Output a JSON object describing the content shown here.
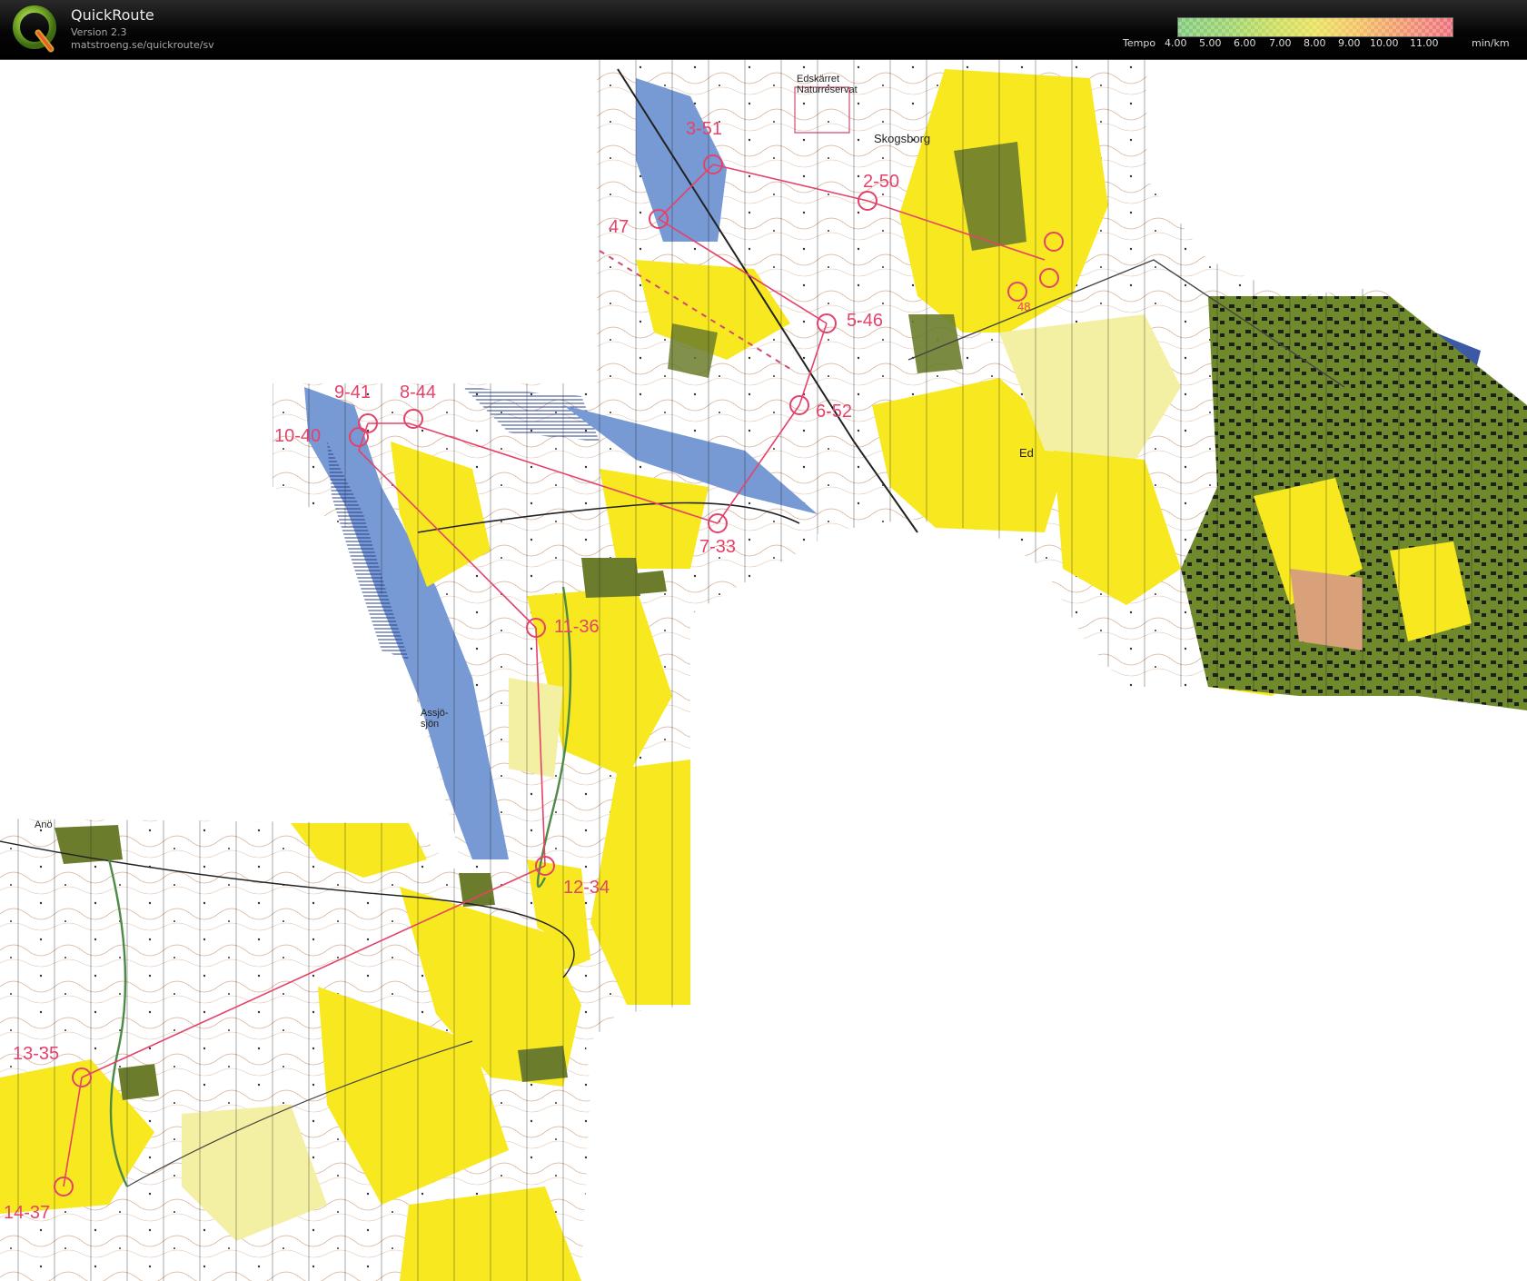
{
  "app": {
    "title": "QuickRoute",
    "version": "Version 2.3",
    "url": "matstroeng.se/quickroute/sv",
    "logo_letter": "Q"
  },
  "legend": {
    "label": "Tempo",
    "unit": "min/km",
    "ticks": [
      "4.00",
      "5.00",
      "6.00",
      "7.00",
      "8.00",
      "9.00",
      "10.00",
      "11.00"
    ]
  },
  "map": {
    "place_names": {
      "edskarret": "Edskärret",
      "naturreservat": "Naturreservat",
      "skogsborg": "Skogsborg",
      "ed": "Ed",
      "assjo": "Assjö-",
      "sjon": "sjön",
      "ano": "Anö"
    },
    "controls": {
      "c3": "3-51",
      "c2": "2-50",
      "c47": "47",
      "c5": "5-46",
      "c6": "6-52",
      "c9": "9-41",
      "c8": "8-44",
      "c10": "10-40",
      "c7": "7-33",
      "c11": "11-36",
      "c12": "12-34",
      "c13": "13-35",
      "c14": "14-37",
      "c48": "48"
    },
    "colors": {
      "forest": "#ffffff",
      "open": "#f7e81f",
      "light_open": "#f4f0a3",
      "water": "#7799d4",
      "marsh": "#3c5aa4",
      "green": "#6b7d2c",
      "contour": "#b5784e",
      "course": "#e5426a",
      "route": "#4c8a46"
    }
  }
}
